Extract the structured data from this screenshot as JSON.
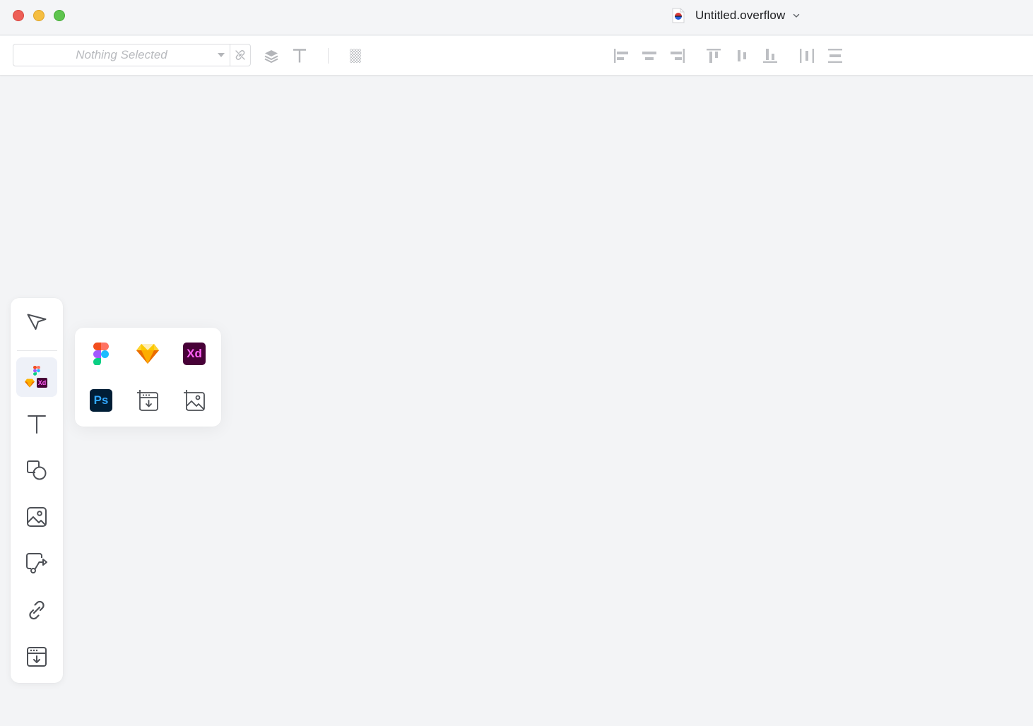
{
  "window": {
    "title": "Untitled.overflow",
    "controls": [
      "close",
      "minimize",
      "maximize"
    ]
  },
  "toolbar": {
    "selector_placeholder": "Nothing Selected",
    "icons": [
      "unlink-icon",
      "layers-icon",
      "text-style-icon",
      "opacity-icon",
      "align-left-icon",
      "align-horizontal-center-icon",
      "align-right-icon",
      "align-top-icon",
      "align-vertical-center-icon",
      "align-bottom-icon",
      "distribute-horizontal-icon",
      "distribute-vertical-icon"
    ]
  },
  "sidebar": {
    "tools": [
      "select-tool",
      "import-design-tool",
      "text-tool",
      "shape-tool",
      "image-tool",
      "connector-tool",
      "link-tool",
      "embed-tool"
    ],
    "active_tool": "import-design-tool"
  },
  "import_popover": {
    "items": [
      {
        "name": "figma",
        "label": ""
      },
      {
        "name": "sketch",
        "label": ""
      },
      {
        "name": "adobe-xd",
        "label": "Xd"
      },
      {
        "name": "photoshop",
        "label": "Ps"
      },
      {
        "name": "import-screens",
        "label": ""
      },
      {
        "name": "import-images",
        "label": ""
      }
    ]
  },
  "colors": {
    "canvas": "#f3f4f6",
    "accent_active": "#eef1f8",
    "xd_bg": "#470137",
    "xd_fg": "#ff61f6",
    "ps_bg": "#001e36",
    "ps_fg": "#31a8ff"
  }
}
